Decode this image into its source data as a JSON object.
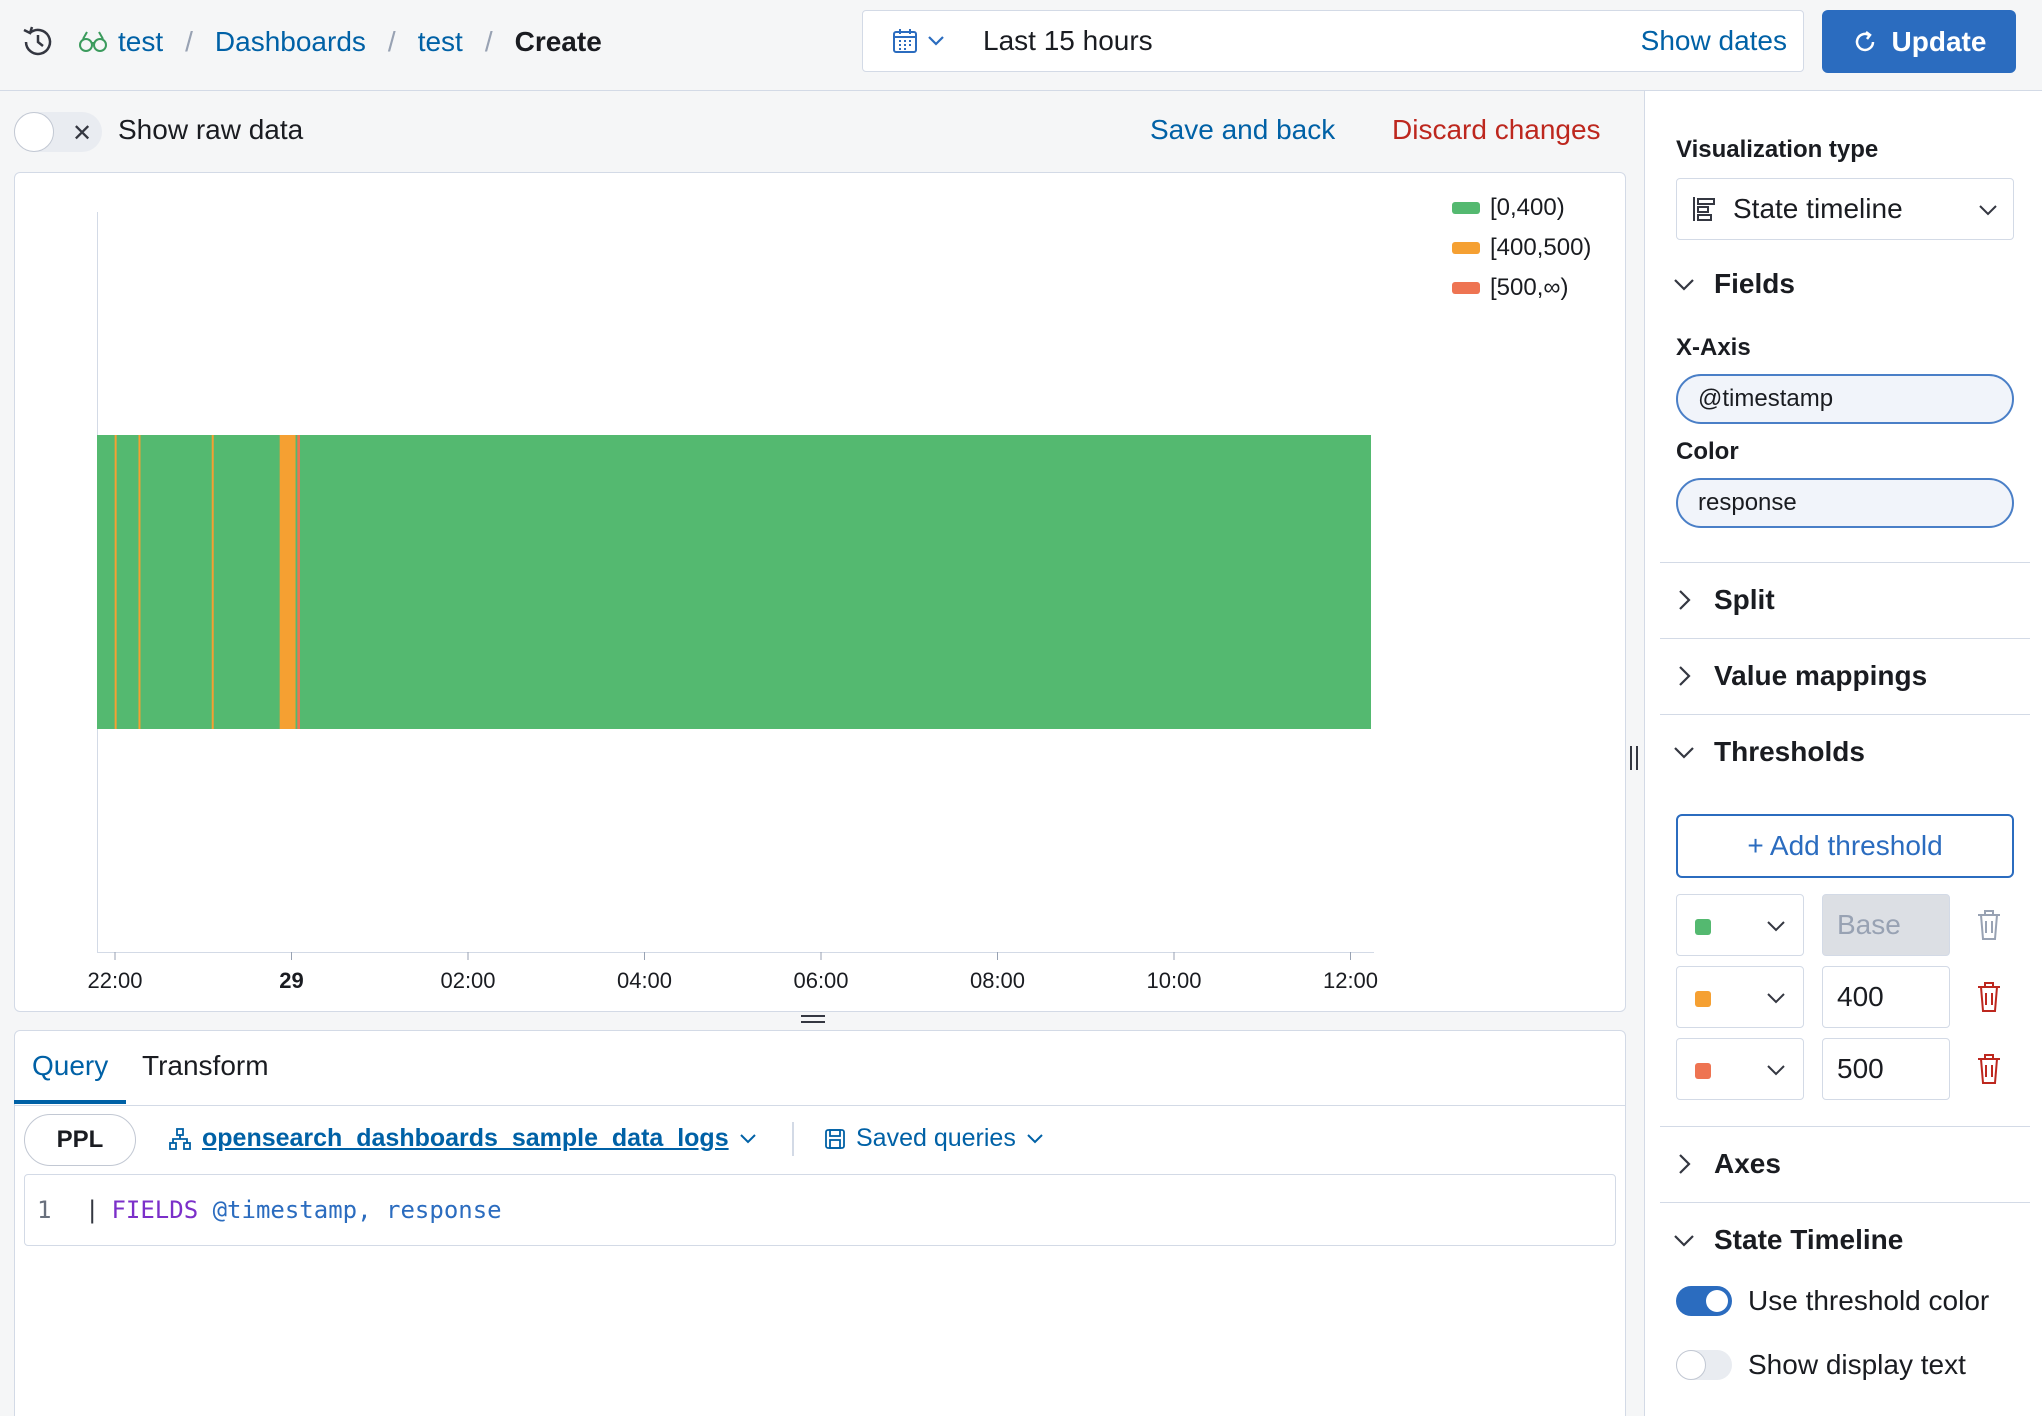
{
  "header": {
    "breadcrumbs": [
      {
        "label": "test"
      },
      {
        "label": "Dashboards"
      },
      {
        "label": "test"
      },
      {
        "label": "Create"
      }
    ],
    "date_range": "Last 15 hours",
    "show_dates": "Show dates",
    "update_label": "Update"
  },
  "toolbar": {
    "show_raw_data": "Show raw data",
    "save_and_back": "Save and back",
    "discard_changes": "Discard changes"
  },
  "chart_data": {
    "type": "state-timeline",
    "x_ticks": [
      "22:00",
      "29",
      "02:00",
      "04:00",
      "06:00",
      "08:00",
      "10:00",
      "12:00"
    ],
    "legend": [
      {
        "label": "[0,400)",
        "color": "#54b970"
      },
      {
        "label": "[400,500)",
        "color": "#f5a032"
      },
      {
        "label": "[500,∞)",
        "color": "#ee7452"
      }
    ],
    "background_state": "[0,400)",
    "state_segments": [
      {
        "state": "[400,500)",
        "hours_from_start": 0.2,
        "width_hours": 0.02
      },
      {
        "state": "[400,500)",
        "hours_from_start": 0.47,
        "width_hours": 0.02
      },
      {
        "state": "[400,500)",
        "hours_from_start": 1.3,
        "width_hours": 0.02
      },
      {
        "state": "[400,500)",
        "hours_from_start": 2.07,
        "width_hours": 0.18
      },
      {
        "state": "[500,∞)",
        "hours_from_start": 2.27,
        "width_hours": 0.03
      }
    ]
  },
  "query": {
    "tabs": [
      "Query",
      "Transform"
    ],
    "language": "PPL",
    "datasource": "opensearch_dashboards_sample_data_logs",
    "saved_queries": "Saved queries",
    "line_number": "1",
    "pipe": "|",
    "keyword": "FIELDS",
    "fields": "@timestamp,",
    "fields2": "response"
  },
  "sidebar": {
    "viz_type_label": "Visualization type",
    "viz_type": "State timeline",
    "fields_section": "Fields",
    "x_axis_label": "X-Axis",
    "x_axis_value": "@timestamp",
    "color_label": "Color",
    "color_value": "response",
    "split_section": "Split",
    "value_mappings_section": "Value mappings",
    "thresholds_section": "Thresholds",
    "add_threshold": "+ Add threshold",
    "thresholds": [
      {
        "color": "#54b970",
        "value": "Base"
      },
      {
        "color": "#f5a032",
        "value": "400"
      },
      {
        "color": "#ee7452",
        "value": "500"
      }
    ],
    "axes_section": "Axes",
    "state_timeline_section": "State Timeline",
    "use_threshold_color": "Use threshold color",
    "show_display_text": "Show display text"
  }
}
